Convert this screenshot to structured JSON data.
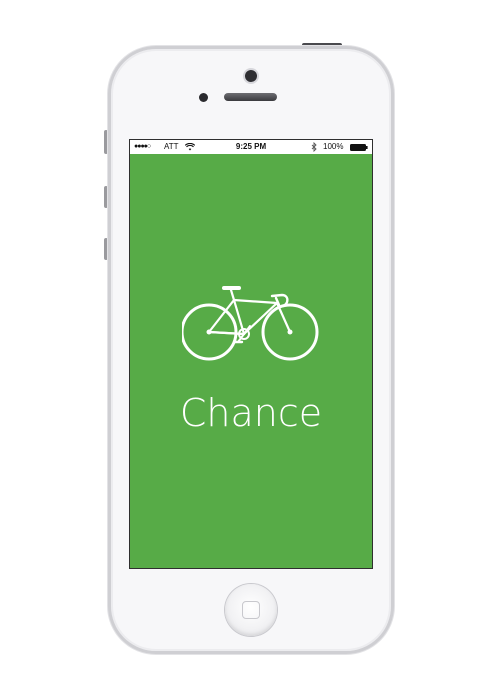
{
  "status_bar": {
    "signal": "●●●●○",
    "carrier": "ATT",
    "time": "9:25 PM",
    "battery_percent": "100%",
    "icons": [
      "wifi-icon",
      "bluetooth-icon",
      "battery-icon"
    ]
  },
  "splash": {
    "app_name": "Chance",
    "icon": "bicycle-icon",
    "background_color": "#57ab47",
    "foreground_color": "#ffffff"
  },
  "device": {
    "model": "iPhone",
    "color": "white"
  }
}
